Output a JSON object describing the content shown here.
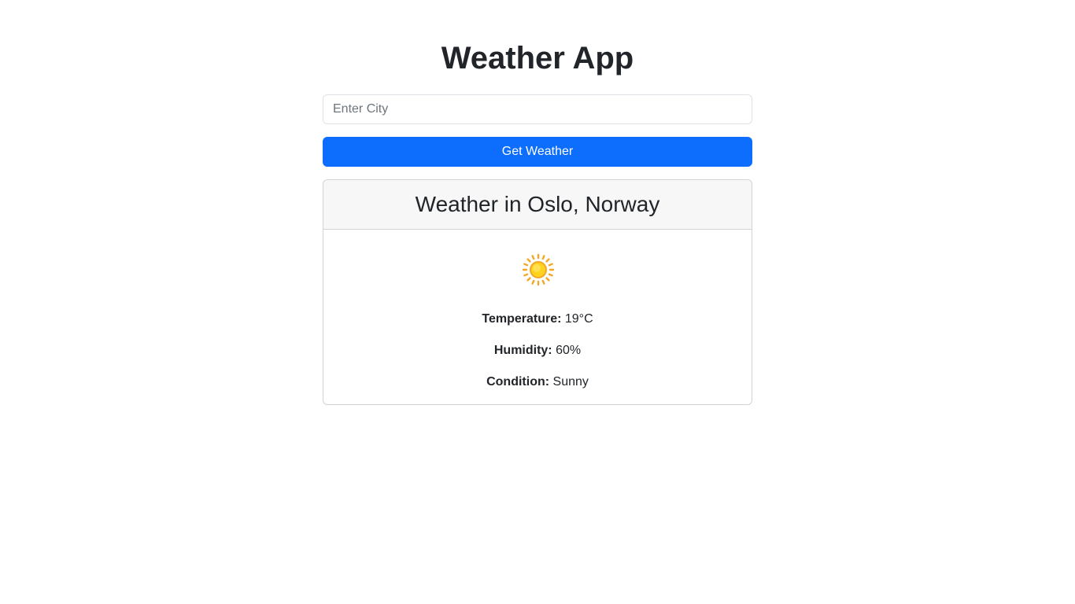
{
  "app": {
    "title": "Weather App"
  },
  "search": {
    "placeholder": "Enter City",
    "value": ""
  },
  "actions": {
    "get_weather_label": "Get Weather"
  },
  "weather": {
    "heading": "Weather in Oslo, Norway",
    "icon": "sun-icon",
    "temperature_label": "Temperature:",
    "temperature_value": "19°C",
    "humidity_label": "Humidity:",
    "humidity_value": "60%",
    "condition_label": "Condition:",
    "condition_value": "Sunny"
  },
  "colors": {
    "primary": "#0d6efd",
    "text": "#212529",
    "header_bg": "#f7f7f7",
    "sun": "#ffc107"
  }
}
